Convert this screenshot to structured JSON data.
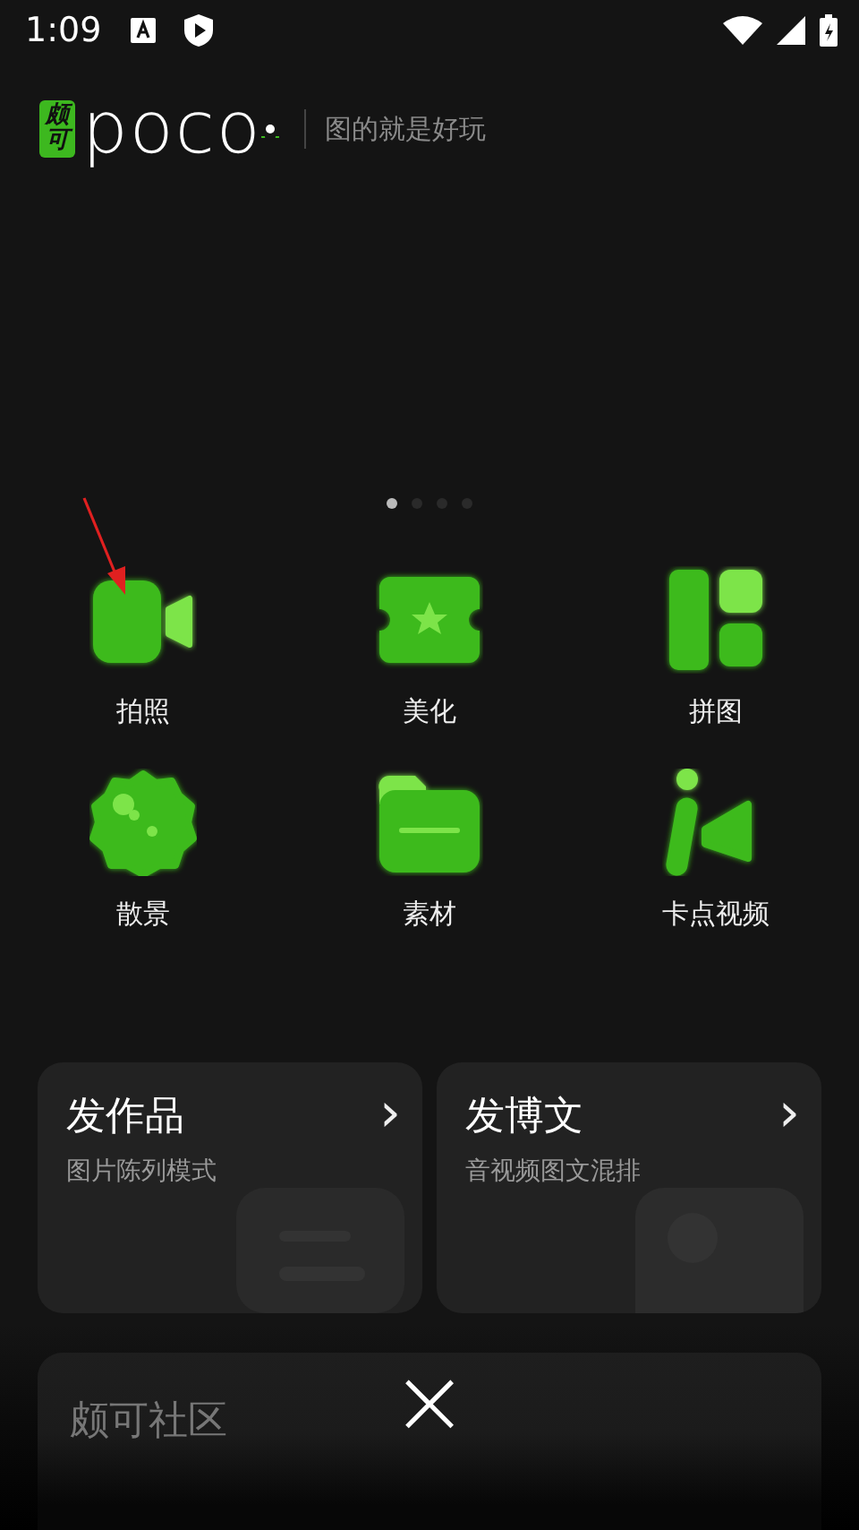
{
  "status_bar": {
    "time": "1:09"
  },
  "header": {
    "logo_badge": "颇可",
    "logo_text": "poco",
    "tagline": "图的就是好玩"
  },
  "pager": [
    {
      "selected": true
    },
    {
      "selected": false
    },
    {
      "selected": false
    },
    {
      "selected": false
    }
  ],
  "tools": [
    {
      "label": "拍照"
    },
    {
      "label": "美化"
    },
    {
      "label": "拼图"
    },
    {
      "label": "散景"
    },
    {
      "label": "素材"
    },
    {
      "label": "卡点视频"
    }
  ],
  "cards": [
    {
      "title": "发作品",
      "subtitle": "图片陈列模式",
      "chevron": "›"
    },
    {
      "title": "发博文",
      "subtitle": "音视频图文混排",
      "chevron": "›"
    }
  ],
  "community": {
    "title": "颇可社区"
  },
  "close": "×"
}
